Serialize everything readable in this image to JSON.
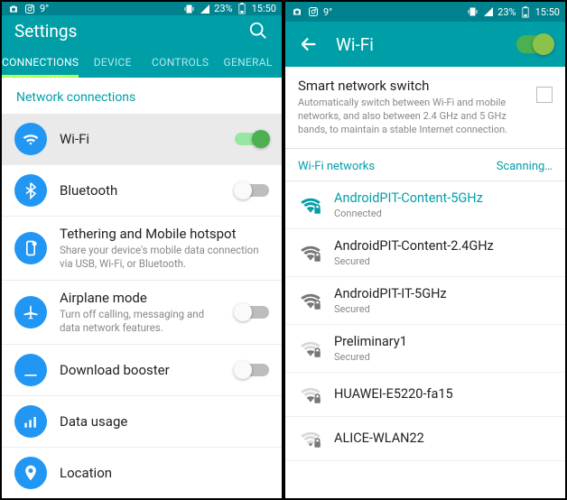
{
  "colors": {
    "teal": "#009fa8",
    "tealDark": "#00838f",
    "blue": "#2196f3",
    "green": "#4caf50"
  },
  "statusbar": {
    "temp": "9°",
    "battery": "23%",
    "time": "15:50"
  },
  "screenA": {
    "title": "Settings",
    "tabs": [
      "CONNECTIONS",
      "DEVICE",
      "CONTROLS",
      "GENERAL"
    ],
    "activeTab": 0,
    "section": "Network connections",
    "items": [
      {
        "id": "wifi",
        "label": "Wi-Fi",
        "hasToggle": true,
        "toggled": true,
        "selected": true
      },
      {
        "id": "bluetooth",
        "label": "Bluetooth",
        "hasToggle": true,
        "toggled": false
      },
      {
        "id": "tethering",
        "label": "Tethering and Mobile hotspot",
        "desc": "Share your device's mobile data connection via USB, Wi-Fi, or Bluetooth."
      },
      {
        "id": "airplane",
        "label": "Airplane mode",
        "desc": "Turn off calling, messaging and data network features.",
        "hasToggle": true,
        "toggled": false
      },
      {
        "id": "booster",
        "label": "Download booster",
        "hasToggle": true,
        "toggled": false
      },
      {
        "id": "data",
        "label": "Data usage"
      },
      {
        "id": "location",
        "label": "Location"
      }
    ]
  },
  "screenB": {
    "title": "Wi-Fi",
    "masterToggle": true,
    "smartSwitch": {
      "title": "Smart network switch",
      "desc": "Automatically switch between Wi-Fi and mobile networks, and also between 2.4 GHz and 5 GHz bands, to maintain a stable Internet connection.",
      "checked": false
    },
    "networksHeading": "Wi-Fi networks",
    "scanning": "Scanning…",
    "networks": [
      {
        "ssid": "AndroidPIT-Content-5GHz",
        "status": "Connected",
        "connected": true,
        "secured": true,
        "strength": 4
      },
      {
        "ssid": "AndroidPIT-Content-2.4GHz",
        "status": "Secured",
        "secured": true,
        "strength": 4
      },
      {
        "ssid": "AndroidPIT-IT-5GHz",
        "status": "Secured",
        "secured": true,
        "strength": 4
      },
      {
        "ssid": "Preliminary1",
        "status": "Secured",
        "secured": true,
        "strength": 2
      },
      {
        "ssid": "HUAWEI-E5220-fa15",
        "status": "",
        "secured": true,
        "strength": 2
      },
      {
        "ssid": "ALICE-WLAN22",
        "status": "",
        "secured": true,
        "strength": 1
      }
    ]
  }
}
